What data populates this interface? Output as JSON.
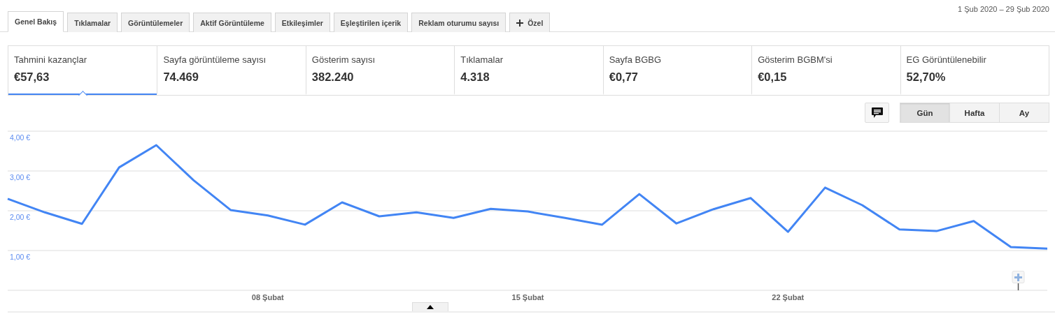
{
  "date_range": "1 Şub 2020 – 29 Şub 2020",
  "tabs": [
    {
      "label": "Genel Bakış",
      "selected": true
    },
    {
      "label": "Tıklamalar",
      "selected": false
    },
    {
      "label": "Görüntülemeler",
      "selected": false
    },
    {
      "label": "Aktif Görüntüleme",
      "selected": false
    },
    {
      "label": "Etkileşimler",
      "selected": false
    },
    {
      "label": "Eşleştirilen içerik",
      "selected": false
    },
    {
      "label": "Reklam oturumu sayısı",
      "selected": false
    },
    {
      "label": "Özel",
      "selected": false,
      "kind": "add"
    }
  ],
  "metrics": [
    {
      "label": "Tahmini kazançlar",
      "value": "€57,63",
      "selected": true
    },
    {
      "label": "Sayfa görüntüleme sayısı",
      "value": "74.469",
      "selected": false
    },
    {
      "label": "Gösterim sayısı",
      "value": "382.240",
      "selected": false
    },
    {
      "label": "Tıklamalar",
      "value": "4.318",
      "selected": false
    },
    {
      "label": "Sayfa BGBG",
      "value": "€0,77",
      "selected": false
    },
    {
      "label": "Gösterim BGBM'si",
      "value": "€0,15",
      "selected": false
    },
    {
      "label": "EG Görüntülenebilir",
      "value": "52,70%",
      "selected": false
    }
  ],
  "periods": [
    {
      "label": "Gün",
      "selected": true
    },
    {
      "label": "Hafta",
      "selected": false
    },
    {
      "label": "Ay",
      "selected": false
    }
  ],
  "chart": {
    "chart_data": {
      "type": "line",
      "x": [
        1,
        2,
        3,
        4,
        5,
        6,
        7,
        8,
        9,
        10,
        11,
        12,
        13,
        14,
        15,
        16,
        17,
        18,
        19,
        20,
        21,
        22,
        23,
        24,
        25,
        26,
        27,
        28,
        29
      ],
      "grid": true,
      "series": [
        {
          "color": "#4285f4",
          "values": [
            2.3,
            1.96,
            1.67,
            3.09,
            3.65,
            2.77,
            2.02,
            1.88,
            1.65,
            2.21,
            1.86,
            1.96,
            1.82,
            2.05,
            1.98,
            1.82,
            1.65,
            2.42,
            1.68,
            2.04,
            2.32,
            1.47,
            2.58,
            2.14,
            1.53,
            1.49,
            1.74,
            1.09,
            1.05
          ]
        }
      ],
      "xlim": [
        1,
        29
      ],
      "ylim": [
        0,
        4
      ],
      "xticks": [
        {
          "value": 8,
          "label": "08 Şubat"
        },
        {
          "value": 15,
          "label": "15 Şubat"
        },
        {
          "value": 22,
          "label": "22 Şubat"
        }
      ],
      "yticks": [
        {
          "value": 1,
          "label": "1,00 €"
        },
        {
          "value": 2,
          "label": "2,00 €"
        },
        {
          "value": 3,
          "label": "3,00 €"
        },
        {
          "value": 4,
          "label": "4,00 €"
        }
      ]
    }
  }
}
